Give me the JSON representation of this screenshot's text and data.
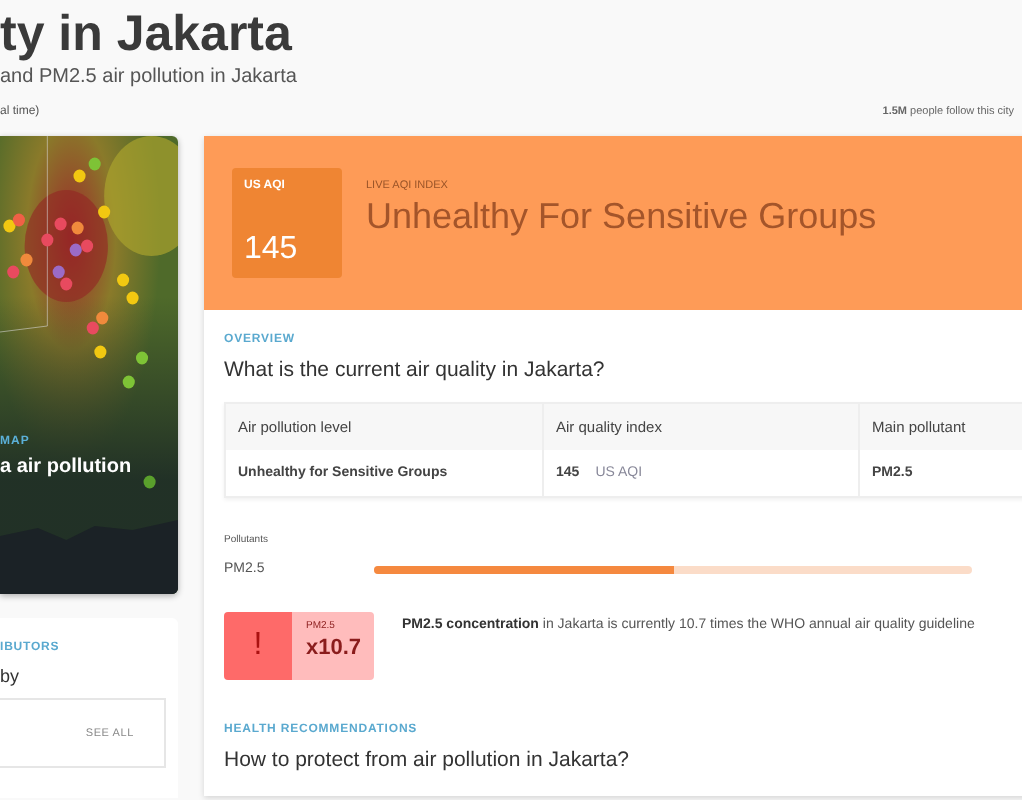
{
  "header": {
    "title": "ty in Jakarta",
    "subtitle": "and PM2.5 air pollution in Jakarta",
    "note": "al time)",
    "followers": "1.5M",
    "followers_text": "people follow this city"
  },
  "map_card": {
    "label": "MAP",
    "title": "a air pollution"
  },
  "contributors": {
    "label": "IBUTORS",
    "title": "by",
    "link": "SEE ALL"
  },
  "aqi": {
    "badge_label": "US AQI",
    "value": "145",
    "index_label": "LIVE AQI INDEX",
    "status": "Unhealthy For Sensitive Groups",
    "color": "#fe9b57"
  },
  "overview": {
    "label": "OVERVIEW",
    "question": "What is the current air quality in Jakarta?",
    "table": {
      "columns": [
        "Air pollution level",
        "Air quality index",
        "Main pollutant"
      ],
      "rows": [
        {
          "level": "Unhealthy for Sensitive Groups",
          "index": "145",
          "unit": "US AQI",
          "pollutant": "PM2.5"
        }
      ]
    }
  },
  "pollutants": {
    "label": "Pollutants",
    "items": [
      {
        "name": "PM2.5",
        "level": 0.5
      }
    ]
  },
  "concentration": {
    "icon": "!",
    "pollutant": "PM2.5",
    "factor": "x10.7",
    "text": "**PM2.5 concentration** in Jakarta is currently 10.7 times the WHO annual air quality guideline"
  },
  "health": {
    "label": "HEALTH RECOMMENDATIONS",
    "question": "How to protect from air pollution in Jakarta?"
  }
}
